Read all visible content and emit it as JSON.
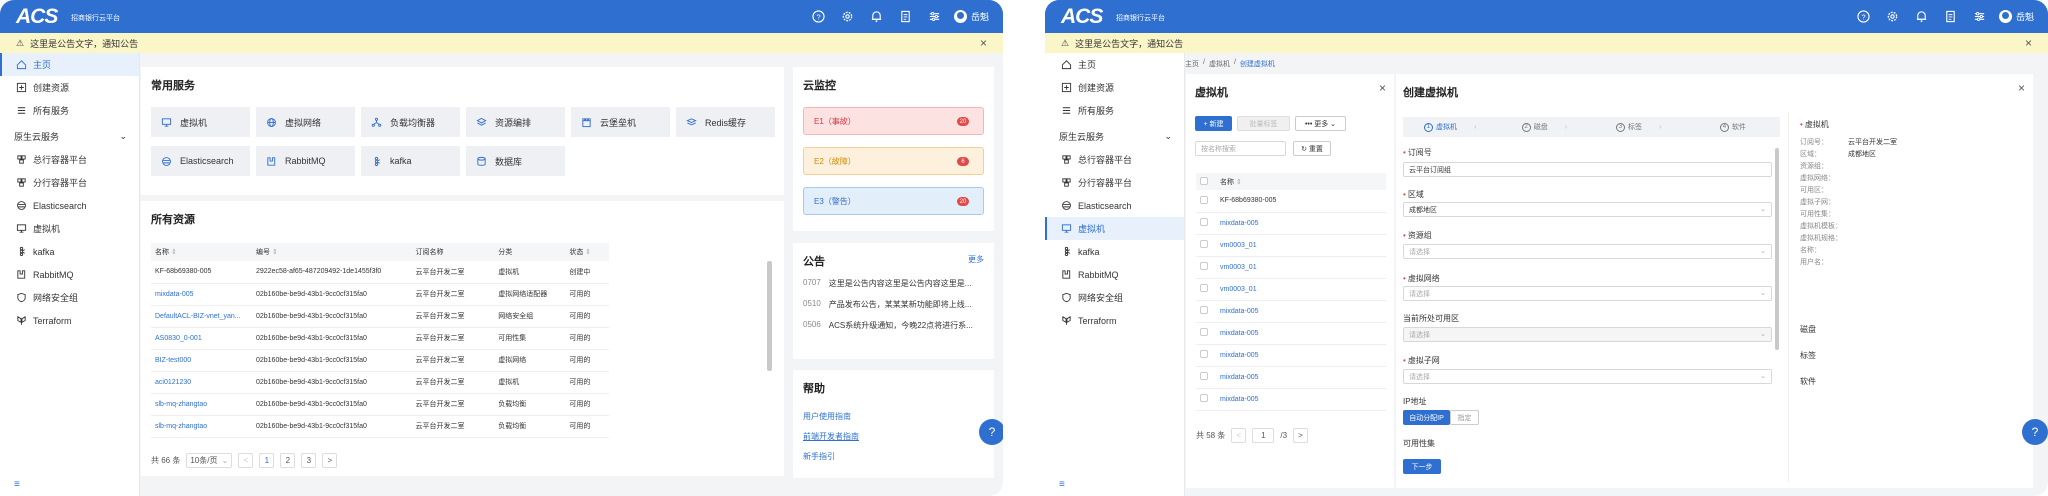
{
  "app": {
    "logo": "ACS",
    "logo_sub": "招商银行云平台",
    "user": "岳魁"
  },
  "notice": {
    "text": "这里是公告文字，通知公告"
  },
  "sidebar": {
    "items": [
      {
        "label": "主页",
        "icon": "home-icon"
      },
      {
        "label": "创建资源",
        "icon": "plus-square-icon"
      },
      {
        "label": "所有服务",
        "icon": "list-icon"
      }
    ],
    "group": "原生云服务",
    "services": [
      {
        "label": "总行容器平台",
        "icon": "cluster-icon"
      },
      {
        "label": "分行容器平台",
        "icon": "cluster-icon"
      },
      {
        "label": "Elasticsearch",
        "icon": "elastic-icon"
      },
      {
        "label": "虚拟机",
        "icon": "monitor-icon"
      },
      {
        "label": "kafka",
        "icon": "kafka-icon"
      },
      {
        "label": "RabbitMQ",
        "icon": "rabbitmq-icon"
      },
      {
        "label": "网络安全组",
        "icon": "shield-icon"
      },
      {
        "label": "Terraform",
        "icon": "terraform-icon"
      }
    ]
  },
  "home": {
    "common_title": "常用服务",
    "common": [
      {
        "label": "虚拟机",
        "icon": "monitor-icon"
      },
      {
        "label": "虚拟网络",
        "icon": "globe-icon"
      },
      {
        "label": "负载均衡器",
        "icon": "balance-icon"
      },
      {
        "label": "资源编排",
        "icon": "layers-icon"
      },
      {
        "label": "云堡垒机",
        "icon": "fortress-icon"
      },
      {
        "label": "Redis缓存",
        "icon": "redis-icon"
      },
      {
        "label": "Elasticsearch",
        "icon": "elastic-icon"
      },
      {
        "label": "RabbitMQ",
        "icon": "rabbitmq-icon"
      },
      {
        "label": "kafka",
        "icon": "kafka-icon"
      },
      {
        "label": "数据库",
        "icon": "database-icon"
      }
    ],
    "resources_title": "所有资源",
    "columns": [
      "名称",
      "编号",
      "订阅名称",
      "分类",
      "状态"
    ],
    "rows": [
      [
        "KF-68b69380-005",
        "2922ec58-af65-487209492-1de1455f3f0",
        "云平台开发二室",
        "虚拟机",
        "创建中"
      ],
      [
        "mixdata-005",
        "02b160be-be9d-43b1-9cc0cf315fa0",
        "云平台开发二室",
        "虚拟网络适配器",
        "可用的"
      ],
      [
        "DefaultACL-BIZ-vnet_yan...",
        "02b160be-be9d-43b1-9cc0cf315fa0",
        "云平台开发二室",
        "网络安全组",
        "可用的"
      ],
      [
        "AS0830_0-001",
        "02b160be-be9d-43b1-9cc0cf315fa0",
        "云平台开发二室",
        "可用性集",
        "可用的"
      ],
      [
        "BIZ-test000",
        "02b160be-be9d-43b1-9cc0cf315fa0",
        "云平台开发二室",
        "虚拟网络",
        "可用的"
      ],
      [
        "aci0121230",
        "02b160be-be9d-43b1-9cc0cf315fa0",
        "云平台开发二室",
        "虚拟机",
        "可用的"
      ],
      [
        "slb-mq-zhangtao",
        "02b160be-be9d-43b1-9cc0cf315fa0",
        "云平台开发二室",
        "负载均衡",
        "可用的"
      ],
      [
        "slb-mq-zhangtao",
        "02b160be-be9d-43b1-9cc0cf315fa0",
        "云平台开发二室",
        "负载均衡",
        "可用的"
      ]
    ],
    "pager": {
      "total": "共 66 条",
      "size": "10条/页",
      "pages": [
        "1",
        "2",
        "3"
      ]
    },
    "monitor_title": "云监控",
    "alerts": [
      {
        "label": "E1（事故）",
        "count": "20",
        "bg": "#fde2e2",
        "border": "#f5b5b5",
        "color": "#d9363e"
      },
      {
        "label": "E2（故障）",
        "count": "6",
        "bg": "#fdf0dc",
        "border": "#f3cf95",
        "color": "#d48806"
      },
      {
        "label": "E3（警告）",
        "count": "20",
        "bg": "#e3eefb",
        "border": "#a9c8ef",
        "color": "#2f6fd0"
      }
    ],
    "announce_title": "公告",
    "announce_more": "更多",
    "announcements": [
      {
        "date": "0707",
        "text": "这里是公告内容这里是公告内容这里是..."
      },
      {
        "date": "0510",
        "text": "产品发布公告，某某某新功能即将上线..."
      },
      {
        "date": "0506",
        "text": "ACS系统升级通知，今晚22点将进行系..."
      }
    ],
    "help_title": "帮助",
    "help": [
      "用户使用指南",
      "前端开发者指南",
      "新手指引"
    ]
  },
  "vm": {
    "breadcrumb": [
      "主页",
      "虚拟机",
      "创建虚拟机"
    ],
    "panel_title": "虚拟机",
    "new_btn": "+ 新建",
    "batch_btn": "批量标签",
    "more_btn": "••• 更多",
    "search_placeholder": "按名称搜索",
    "reset_btn": "重置",
    "col_name": "名称",
    "names": [
      "KF-68b69380-005",
      "mixdata-005",
      "vm0003_01",
      "vm0003_01",
      "vm0003_01",
      "mixdata-005",
      "mixdata-005",
      "mixdata-005",
      "mixdata-005",
      "mixdata-005"
    ],
    "total": "共 58 条",
    "page": "1",
    "page_total": "/3"
  },
  "create": {
    "title": "创建虚拟机",
    "steps": [
      "虚拟机",
      "磁盘",
      "标签",
      "软件"
    ],
    "fields": {
      "subscription_label": "订阅号",
      "subscription_value": "云平台订阅组",
      "region_label": "区域",
      "region_value": "成都地区",
      "rg_label": "资源组",
      "select_placeholder": "请选择",
      "vnet_label": "虚拟网络",
      "zone_label": "当前所处可用区",
      "subnet_label": "虚拟子网",
      "ip_label": "IP地址",
      "ip_auto": "自动分配IP",
      "ip_fixed": "指定",
      "avset_label": "可用性集"
    },
    "next_btn": "下一步",
    "summary": {
      "head": "虚拟机",
      "rows": [
        {
          "k": "订阅号：",
          "v": "云平台开发二室"
        },
        {
          "k": "区域：",
          "v": "成都地区"
        },
        {
          "k": "资源组：",
          "v": ""
        },
        {
          "k": "虚拟网络：",
          "v": ""
        },
        {
          "k": "可用区：",
          "v": ""
        },
        {
          "k": "虚拟子网：",
          "v": ""
        },
        {
          "k": "可用性集：",
          "v": ""
        },
        {
          "k": "虚拟机模板：",
          "v": ""
        },
        {
          "k": "虚拟机规格：",
          "v": ""
        },
        {
          "k": "名称：",
          "v": ""
        },
        {
          "k": "用户名：",
          "v": ""
        }
      ],
      "sections": [
        "磁盘",
        "标签",
        "软件"
      ]
    }
  }
}
